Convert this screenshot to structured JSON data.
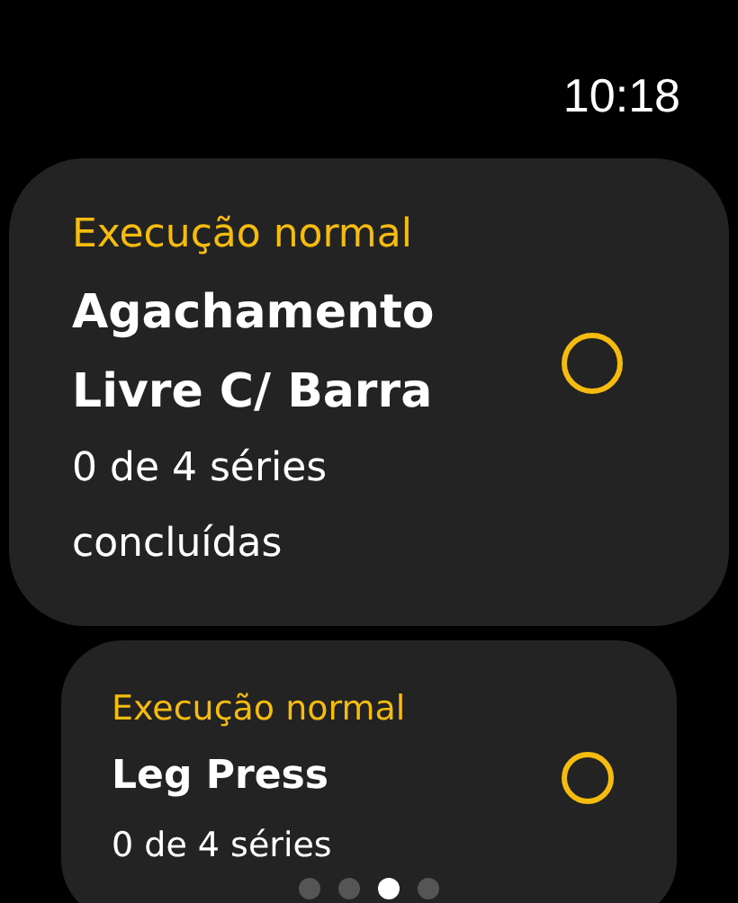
{
  "status_bar": {
    "time": "10:18"
  },
  "exercises": [
    {
      "mode": "Execução normal",
      "name": "Agachamento Livre C/ Barra",
      "progress": "0 de 4 séries concluídas",
      "checked": false
    },
    {
      "mode": "Execução normal",
      "name": "Leg Press",
      "progress": "0 de 4 séries",
      "checked": false
    }
  ],
  "pager": [
    {
      "selected": false
    },
    {
      "selected": false
    },
    {
      "selected": true
    },
    {
      "selected": false
    }
  ]
}
